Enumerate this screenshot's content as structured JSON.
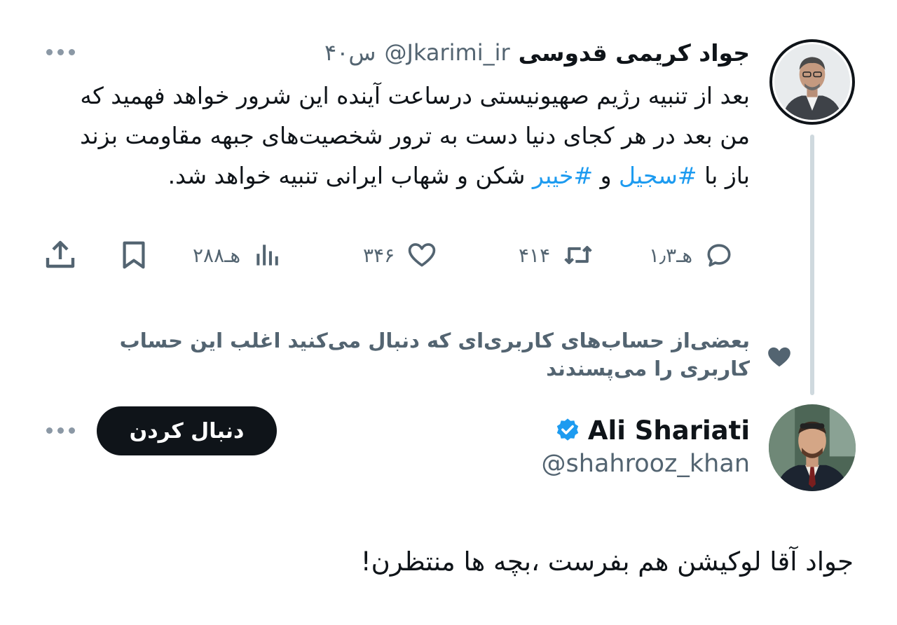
{
  "tweet": {
    "author_name": "جواد کریمی قدوسی",
    "author_handle": "@Jkarimi_ir",
    "time": "۴۰س",
    "text_segments": [
      "بعد از تنبیه رژیم صهیونیستی درساعت آینده این شرور خواهد فهمید که من بعد در هر کجای دنیا دست به ترور شخصیت‌های جبهه مقاومت بزند باز با ",
      "#سجیل",
      " و ",
      "#خیبر",
      " شکن و شهاب ایرانی تنبیه خواهد شد."
    ],
    "actions": {
      "replies": "۱٫۳هـ",
      "retweets": "۴۱۴",
      "likes": "۳۴۶",
      "views": "۲۸۸هـ"
    }
  },
  "social_context": "بعضی‌از حساب‌های کاربری‌ای که دنبال می‌کنید اغلب این حساب کاربری را می‌پسندند",
  "suggested_user": {
    "name": "Ali Shariati",
    "handle": "@shahrooz_khan",
    "verified": true,
    "follow_label": "دنبال کردن",
    "bio": "جواد آقا لوکیشن هم بفرست ،بچه ها منتظرن!"
  },
  "colors": {
    "text": "#0f1419",
    "secondary": "#536471",
    "link": "#1d9bf0",
    "verified": "#1d9bf0",
    "button_bg": "#0f1419"
  },
  "icons": [
    "more-icon",
    "reply-icon",
    "retweet-icon",
    "like-icon",
    "views-icon",
    "bookmark-icon",
    "share-icon",
    "heart-context-icon",
    "verified-badge-icon"
  ]
}
